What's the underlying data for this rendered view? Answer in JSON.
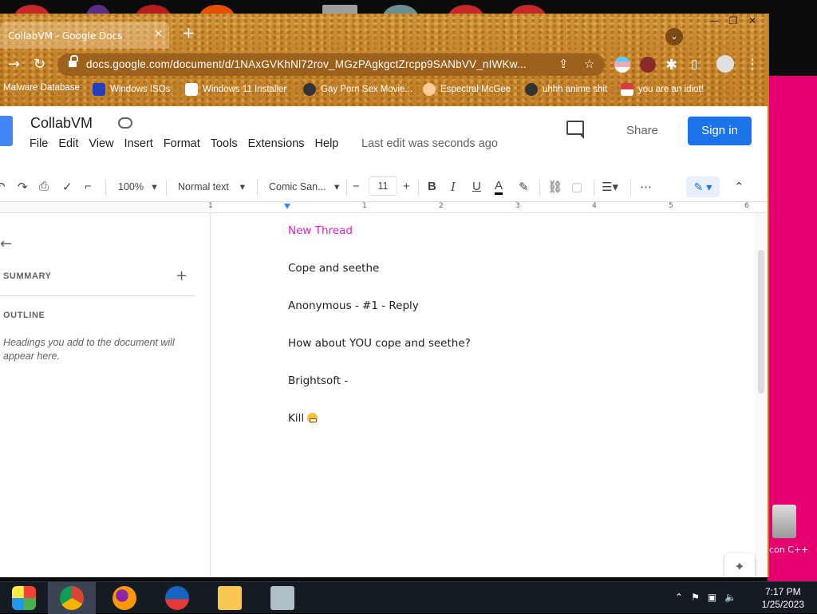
{
  "browser": {
    "tab_title": "CollabVM - Google Docs",
    "tab_close": "×",
    "new_tab": "+",
    "tab_search": "⌄",
    "url": "docs.google.com/document/d/1NAxGVKhNl72rov_MGzPAgkgctZrcpp9SANbVV_nIWKw...",
    "bookmarks": [
      {
        "label": "Malware Database",
        "color": "#c8852c"
      },
      {
        "label": "Windows ISOs",
        "color": "#1f3fbf"
      },
      {
        "label": "Windows 11 Installer",
        "color": "#ffffff"
      },
      {
        "label": "Gay Porn Sex Movie...",
        "color": "#222222"
      },
      {
        "label": "Espectral McGee",
        "color": "#ffcc99"
      },
      {
        "label": "uhhh anime shit",
        "color": "#333333"
      },
      {
        "label": "you are an idiot!",
        "color": "#d33f3f"
      }
    ]
  },
  "docs": {
    "title": "CollabVM",
    "menu": [
      "File",
      "Edit",
      "View",
      "Insert",
      "Format",
      "Tools",
      "Extensions",
      "Help"
    ],
    "last_edit": "Last edit was seconds ago",
    "share_label": "Share",
    "signin_label": "Sign in",
    "toolbar": {
      "zoom": "100%",
      "style": "Normal text",
      "font": "Comic San...",
      "font_size": "11"
    },
    "ruler_numbers": [
      "1",
      "1",
      "2",
      "3",
      "4",
      "5",
      "6"
    ],
    "sidebar": {
      "summary_label": "SUMMARY",
      "outline_label": "OUTLINE",
      "outline_hint": "Headings you add to the document will appear here."
    },
    "lines": [
      {
        "text": "New Thread",
        "accent": true
      },
      {
        "text": "Cope and seethe",
        "accent": false
      },
      {
        "text": "Anonymous - #1 - Reply",
        "accent": false
      },
      {
        "text": "How about YOU cope and seethe?",
        "accent": false
      },
      {
        "text": "Brightsoft -",
        "accent": false
      },
      {
        "text": "Kill",
        "accent": false,
        "emoji": "grimacing-face"
      }
    ]
  },
  "desktop": {
    "recycle_label": "con C++"
  },
  "taskbar": {
    "time": "7:17 PM",
    "date": "1/25/2023"
  },
  "colors": {
    "signin_blue": "#1a73e8",
    "accent_magenta": "#e020c8",
    "frame_brown": "#c8852c"
  }
}
